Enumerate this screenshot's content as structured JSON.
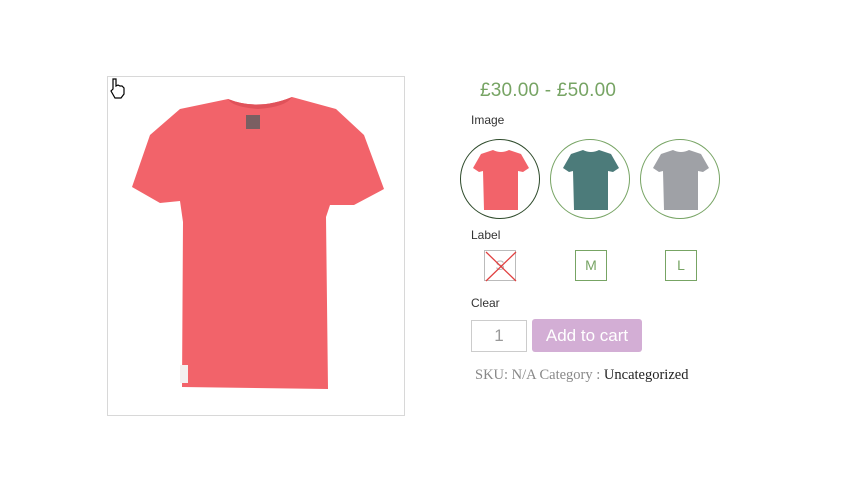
{
  "product": {
    "price": "£30.00 - £50.00",
    "image_alt": "red t-shirt",
    "main_color": "#f2636a"
  },
  "variations": {
    "image_label": "Image",
    "image_swatches": [
      {
        "name": "red",
        "color": "#f2636a",
        "selected": true
      },
      {
        "name": "teal",
        "color": "#4c7b7a",
        "selected": false
      },
      {
        "name": "grey",
        "color": "#9fa1a6",
        "selected": false
      }
    ],
    "size_label": "Label",
    "sizes": [
      {
        "label": "S",
        "available": false
      },
      {
        "label": "M",
        "available": true
      },
      {
        "label": "L",
        "available": true
      }
    ],
    "clear_label": "Clear"
  },
  "cart": {
    "quantity": "1",
    "add_label": "Add to cart"
  },
  "meta": {
    "sku_label": "SKU:",
    "sku_value": "N/A",
    "category_label": "Category :",
    "category_value": "Uncategorized"
  },
  "colors": {
    "accent": "#77a464",
    "button": "#d3aed5"
  }
}
